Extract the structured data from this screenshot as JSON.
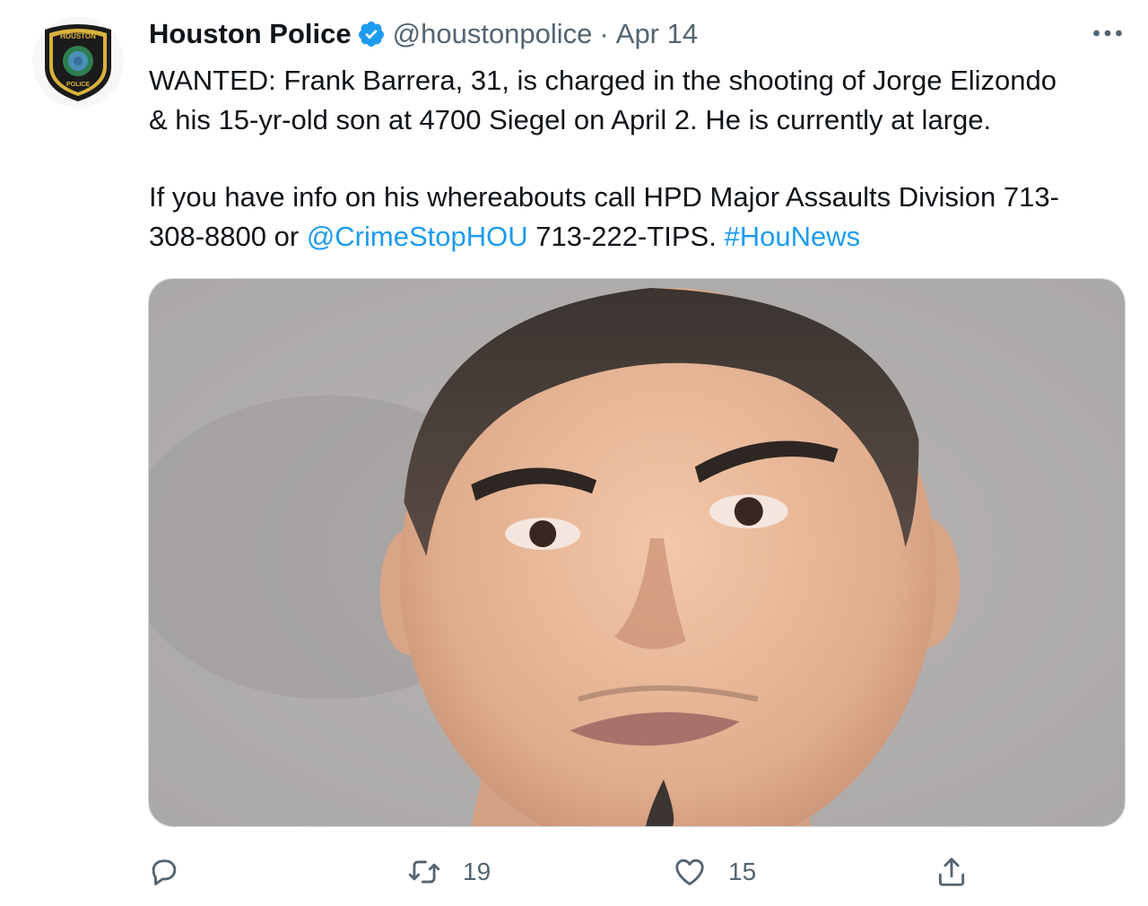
{
  "author": {
    "name": "Houston Police",
    "handle": "@houstonpolice",
    "separator": "·",
    "date": "Apr 14",
    "avatar_badge_top": "HOUSTON",
    "avatar_badge_bottom": "POLICE"
  },
  "tweet": {
    "line1_part1": "WANTED: Frank Barrera, 31, is charged in the shooting of Jorge Elizondo",
    "line1_part2": "& his 15-yr-old son at 4700 Siegel on April 2.  He is currently at large.",
    "line2_part1": "If you have info on his whereabouts call HPD Major Assaults Division 713-",
    "line2_part2": "308-8800 or ",
    "mention": "@CrimeStopHOU",
    "line2_part3": " 713-222-TIPS.  ",
    "hashtag": "#HouNews"
  },
  "actions": {
    "reply_count": "",
    "retweet_count": "19",
    "like_count": "15"
  },
  "icons": {
    "verified": "verified-badge-icon",
    "more": "more-options-icon",
    "reply": "reply-icon",
    "retweet": "retweet-icon",
    "like": "heart-icon",
    "share": "share-icon"
  },
  "colors": {
    "accent": "#1d9bf0",
    "text": "#0f1419",
    "secondary": "#536471"
  }
}
